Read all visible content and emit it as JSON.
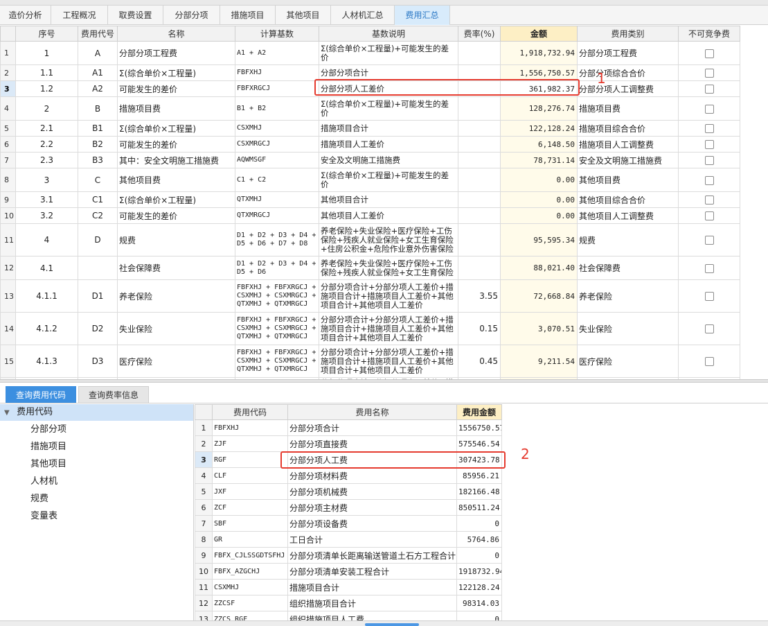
{
  "tabs": [
    {
      "label": "造价分析"
    },
    {
      "label": "工程概况"
    },
    {
      "label": "取费设置"
    },
    {
      "label": "分部分项"
    },
    {
      "label": "措施项目"
    },
    {
      "label": "其他项目"
    },
    {
      "label": "人材机汇总"
    },
    {
      "label": "费用汇总"
    }
  ],
  "fee_table": {
    "headers": {
      "seq": "序号",
      "code": "费用代号",
      "name": "名称",
      "base": "计算基数",
      "desc": "基数说明",
      "rate": "费率(%)",
      "amount": "金额",
      "category": "费用类别",
      "noncompete": "不可竞争费"
    },
    "rows": [
      {
        "rn": "1",
        "seq": "1",
        "code": "A",
        "name": "分部分项工程费",
        "base": "A1 + A2",
        "desc": "Σ(综合单价×工程量)+可能发生的差价",
        "rate": "",
        "amount": "1,918,732.94",
        "category": "分部分项工程费"
      },
      {
        "rn": "2",
        "seq": "1.1",
        "code": "A1",
        "name": "Σ(综合单价×工程量)",
        "base": "FBFXHJ",
        "desc": "分部分项合计",
        "rate": "",
        "amount": "1,556,750.57",
        "category": "分部分项综合合价"
      },
      {
        "rn": "3",
        "seq": "1.2",
        "code": "A2",
        "name": "可能发生的差价",
        "base": "FBFXRGCJ",
        "desc": "分部分项人工差价",
        "rate": "",
        "amount": "361,982.37",
        "category": "分部分项人工调整费"
      },
      {
        "rn": "4",
        "seq": "2",
        "code": "B",
        "name": "措施项目费",
        "base": "B1 + B2",
        "desc": "Σ(综合单价×工程量)+可能发生的差价",
        "rate": "",
        "amount": "128,276.74",
        "category": "措施项目费"
      },
      {
        "rn": "5",
        "seq": "2.1",
        "code": "B1",
        "name": "Σ(综合单价×工程量)",
        "base": "CSXMHJ",
        "desc": "措施项目合计",
        "rate": "",
        "amount": "122,128.24",
        "category": "措施项目综合合价"
      },
      {
        "rn": "6",
        "seq": "2.2",
        "code": "B2",
        "name": "可能发生的差价",
        "base": "CSXMRGCJ",
        "desc": "措施项目人工差价",
        "rate": "",
        "amount": "6,148.50",
        "category": "措施项目人工调整费"
      },
      {
        "rn": "7",
        "seq": "2.3",
        "code": "B3",
        "name": "其中：安全文明施工措施费",
        "base": "AQWMSGF",
        "desc": "安全及文明施工措施费",
        "rate": "",
        "amount": "78,731.14",
        "category": "安全及文明施工措施费"
      },
      {
        "rn": "8",
        "seq": "3",
        "code": "C",
        "name": "其他项目费",
        "base": "C1 + C2",
        "desc": "Σ(综合单价×工程量)+可能发生的差价",
        "rate": "",
        "amount": "0.00",
        "category": "其他项目费"
      },
      {
        "rn": "9",
        "seq": "3.1",
        "code": "C1",
        "name": "Σ(综合单价×工程量)",
        "base": "QTXMHJ",
        "desc": "其他项目合计",
        "rate": "",
        "amount": "0.00",
        "category": "其他项目综合合价"
      },
      {
        "rn": "10",
        "seq": "3.2",
        "code": "C2",
        "name": "可能发生的差价",
        "base": "QTXMRGCJ",
        "desc": "其他项目人工差价",
        "rate": "",
        "amount": "0.00",
        "category": "其他项目人工调整费"
      },
      {
        "rn": "11",
        "seq": "4",
        "code": "D",
        "name": "规费",
        "base": "D1 + D2 + D3 + D4 +\nD5 + D6 + D7 + D8",
        "desc": "养老保险+失业保险+医疗保险+工伤保险+残疾人就业保险+女工生育保险+住房公积金+危险作业意外伤害保险",
        "rate": "",
        "amount": "95,595.34",
        "category": "规费"
      },
      {
        "rn": "12",
        "seq": "4.1",
        "code": "",
        "name": "社会保障费",
        "base": "D1 + D2 + D3 + D4 +\nD5 + D6",
        "desc": "养老保险+失业保险+医疗保险+工伤保险+残疾人就业保险+女工生育保险",
        "rate": "",
        "amount": "88,021.40",
        "category": "社会保障费"
      },
      {
        "rn": "13",
        "seq": "4.1.1",
        "code": "D1",
        "name": "养老保险",
        "base": "FBFXHJ + FBFXRGCJ +\nCSXMHJ + CSXMRGCJ +\nQTXMHJ + QTXMRGCJ",
        "desc": "分部分项合计+分部分项人工差价+措施项目合计+措施项目人工差价+其他项目合计+其他项目人工差价",
        "rate": "3.55",
        "amount": "72,668.84",
        "category": "养老保险"
      },
      {
        "rn": "14",
        "seq": "4.1.2",
        "code": "D2",
        "name": "失业保险",
        "base": "FBFXHJ + FBFXRGCJ +\nCSXMHJ + CSXMRGCJ +\nQTXMHJ + QTXMRGCJ",
        "desc": "分部分项合计+分部分项人工差价+措施项目合计+措施项目人工差价+其他项目合计+其他项目人工差价",
        "rate": "0.15",
        "amount": "3,070.51",
        "category": "失业保险"
      },
      {
        "rn": "15",
        "seq": "4.1.3",
        "code": "D3",
        "name": "医疗保险",
        "base": "FBFXHJ + FBFXRGCJ +\nCSXMHJ + CSXMRGCJ +\nQTXMHJ + QTXMRGCJ",
        "desc": "分部分项合计+分部分项人工差价+措施项目合计+措施项目人工差价+其他项目合计+其他项目人工差价",
        "rate": "0.45",
        "amount": "9,211.54",
        "category": "医疗保险"
      },
      {
        "rn": "",
        "seq": "",
        "code": "",
        "name": "",
        "base": "FBFXHJ + FBFXRGCJ +",
        "desc": "分部分项合计+分部分项人工差价+措",
        "rate": "",
        "amount": "",
        "category": ""
      }
    ]
  },
  "annotations": {
    "label_1": "1",
    "label_2": "2"
  },
  "bottom_tabs": [
    {
      "label": "查询费用代码"
    },
    {
      "label": "查询费率信息"
    }
  ],
  "tree": {
    "root": "费用代码",
    "items": [
      {
        "label": "分部分项"
      },
      {
        "label": "措施项目"
      },
      {
        "label": "其他项目"
      },
      {
        "label": "人材机"
      },
      {
        "label": "规费"
      },
      {
        "label": "变量表"
      }
    ]
  },
  "code_table": {
    "headers": {
      "code": "费用代码",
      "name": "费用名称",
      "amount": "费用金额"
    },
    "rows": [
      {
        "rn": "1",
        "code": "FBFXHJ",
        "name": "分部分项合计",
        "amount": "1556750.57"
      },
      {
        "rn": "2",
        "code": "ZJF",
        "name": "分部分项直接费",
        "amount": "575546.54"
      },
      {
        "rn": "3",
        "code": "RGF",
        "name": "分部分项人工费",
        "amount": "307423.78"
      },
      {
        "rn": "4",
        "code": "CLF",
        "name": "分部分项材料费",
        "amount": "85956.21"
      },
      {
        "rn": "5",
        "code": "JXF",
        "name": "分部分项机械费",
        "amount": "182166.48"
      },
      {
        "rn": "6",
        "code": "ZCF",
        "name": "分部分项主材费",
        "amount": "850511.24"
      },
      {
        "rn": "7",
        "code": "SBF",
        "name": "分部分项设备费",
        "amount": "0"
      },
      {
        "rn": "8",
        "code": "GR",
        "name": "工日合计",
        "amount": "5764.86"
      },
      {
        "rn": "9",
        "code": "FBFX_CJLSSGDTSFHJ",
        "name": "分部分项清单长距离输送管道土石方工程合计",
        "amount": "0"
      },
      {
        "rn": "10",
        "code": "FBFX_AZGCHJ",
        "name": "分部分项清单安装工程合计",
        "amount": "1918732.94"
      },
      {
        "rn": "11",
        "code": "CSXMHJ",
        "name": "措施项目合计",
        "amount": "122128.24"
      },
      {
        "rn": "12",
        "code": "ZZCSF",
        "name": "组织措施项目合计",
        "amount": "98314.03"
      },
      {
        "rn": "13",
        "code": "ZZCS_RGF",
        "name": "组织措施项目人工费",
        "amount": "0"
      }
    ]
  }
}
